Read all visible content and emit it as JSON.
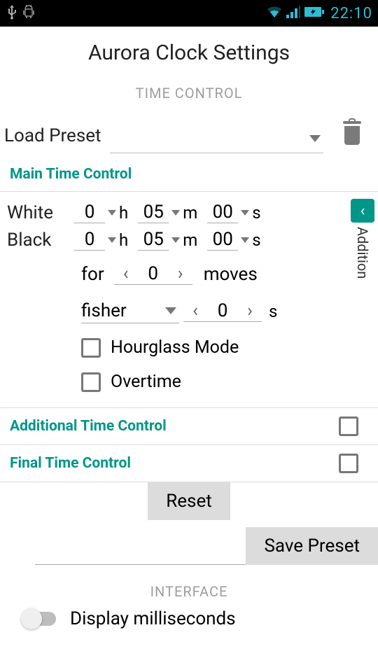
{
  "status": {
    "time": "22:10"
  },
  "title": "Aurora Clock Settings",
  "sections": {
    "time_control": "TIME CONTROL",
    "interface": "INTERFACE"
  },
  "preset": {
    "label": "Load Preset",
    "value": ""
  },
  "main": {
    "header": "Main Time Control",
    "white_label": "White",
    "black_label": "Black",
    "white": {
      "h": "0",
      "m": "05",
      "s": "00"
    },
    "black": {
      "h": "0",
      "m": "05",
      "s": "00"
    },
    "h_unit": "h",
    "m_unit": "m",
    "s_unit": "s",
    "for_label": "for",
    "moves_value": "0",
    "moves_label": "moves",
    "mode": "fisher",
    "increment_value": "0",
    "increment_unit": "s",
    "hourglass": "Hourglass Mode",
    "overtime": "Overtime",
    "side_tab": "Addition"
  },
  "additional": {
    "header": "Additional Time Control",
    "enabled": false
  },
  "final": {
    "header": "Final Time Control",
    "enabled": false
  },
  "buttons": {
    "reset": "Reset",
    "save": "Save Preset"
  },
  "interface": {
    "display_ms": "Display milliseconds",
    "display_ms_on": false
  }
}
